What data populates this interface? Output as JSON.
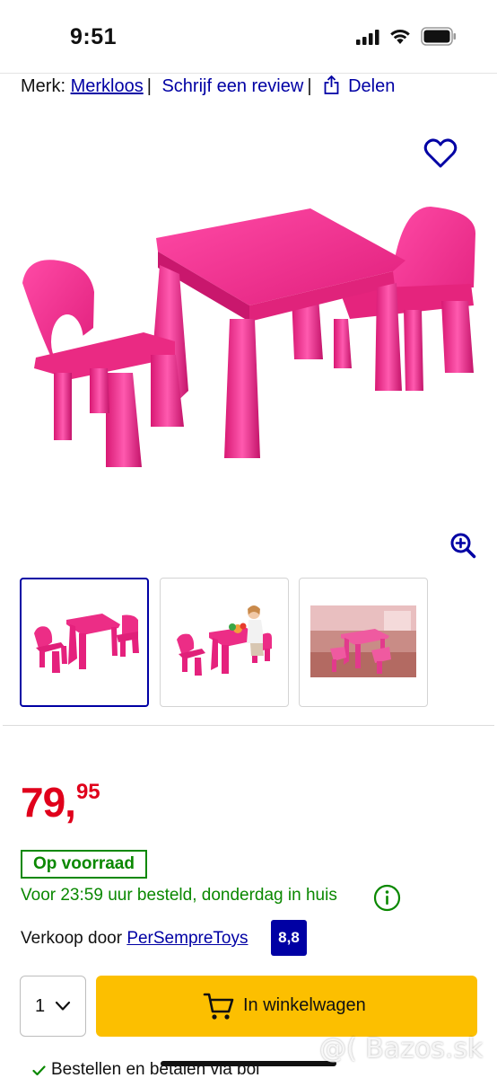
{
  "status_bar": {
    "time": "9:51"
  },
  "brand_row": {
    "brand_prefix": "Merk:",
    "brand_link": "Merkloos",
    "review_link": "Schrijf een review",
    "share_label": "Delen"
  },
  "product": {
    "price_main": "79,",
    "price_cents": "95",
    "stock": "Op voorraad",
    "delivery": "Voor 23:59 uur besteld, donderdag in huis",
    "seller_prefix": "Verkoop door",
    "seller_name": "PerSempreToys",
    "seller_score": "8,8"
  },
  "purchase": {
    "quantity": "1",
    "cart_button": "In winkelwagen"
  },
  "bottom": {
    "text": "Bestellen en betalen via bol"
  },
  "watermark": "@( Bazos.sk",
  "colors": {
    "brand_blue": "#0000a4",
    "price_red": "#e0001b",
    "stock_green": "#0a8800",
    "cart_yellow": "#fcbf00",
    "product_pink": "#e8257f"
  },
  "icons": [
    "signal-icon",
    "wifi-icon",
    "battery-icon",
    "share-icon",
    "heart-icon",
    "zoom-icon",
    "info-icon",
    "chevron-down-icon",
    "cart-icon",
    "check-icon"
  ]
}
